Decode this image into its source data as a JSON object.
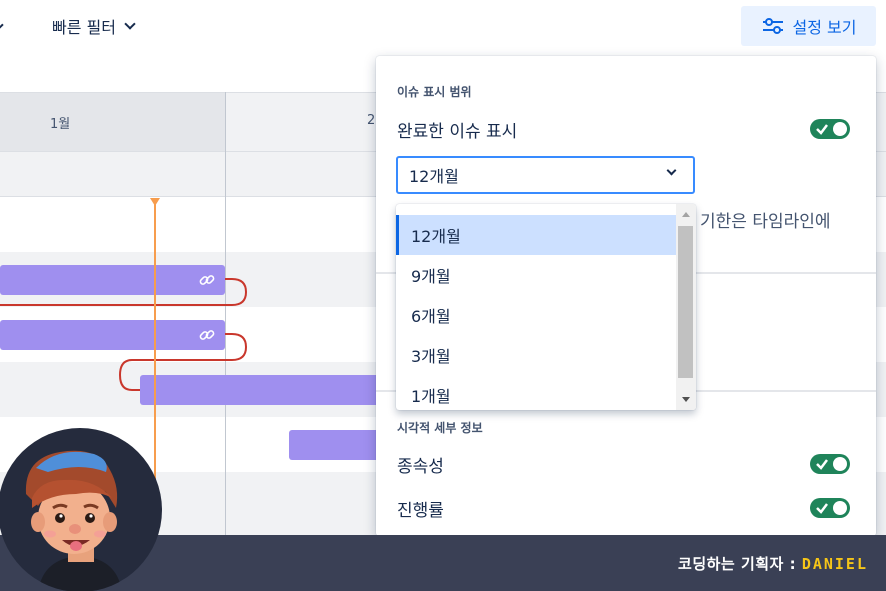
{
  "toolbar": {
    "quick_filter_label": "빠른 필터",
    "view_settings_label": "설정 보기"
  },
  "timeline": {
    "months": [
      "1월",
      "2"
    ]
  },
  "settings_panel": {
    "scope_section_title": "이슈 표시 범위",
    "show_completed_label": "완료한 이슈 표시",
    "show_completed_on": true,
    "range_select_value": "12개월",
    "trailing_text": "기한은 타임라인에",
    "visual_section_title": "시각적 세부 정보",
    "dependencies_label": "종속성",
    "dependencies_on": true,
    "progress_label": "진행률",
    "progress_on": true
  },
  "dropdown": {
    "options": [
      "12개월",
      "9개월",
      "6개월",
      "3개월",
      "1개월"
    ],
    "selected": "12개월"
  },
  "banner": {
    "brand_prefix": "코딩하는 기획자 : ",
    "brand_name": "DANIEL"
  },
  "colors": {
    "accent_blue": "#0c66e4",
    "toggle_green": "#1f845a",
    "bar_purple": "#9f8fef",
    "today_orange": "#f79d4d",
    "dependency_red": "#c9372c",
    "banner_bg": "#3a4055",
    "brand_yellow": "#f5c518"
  }
}
